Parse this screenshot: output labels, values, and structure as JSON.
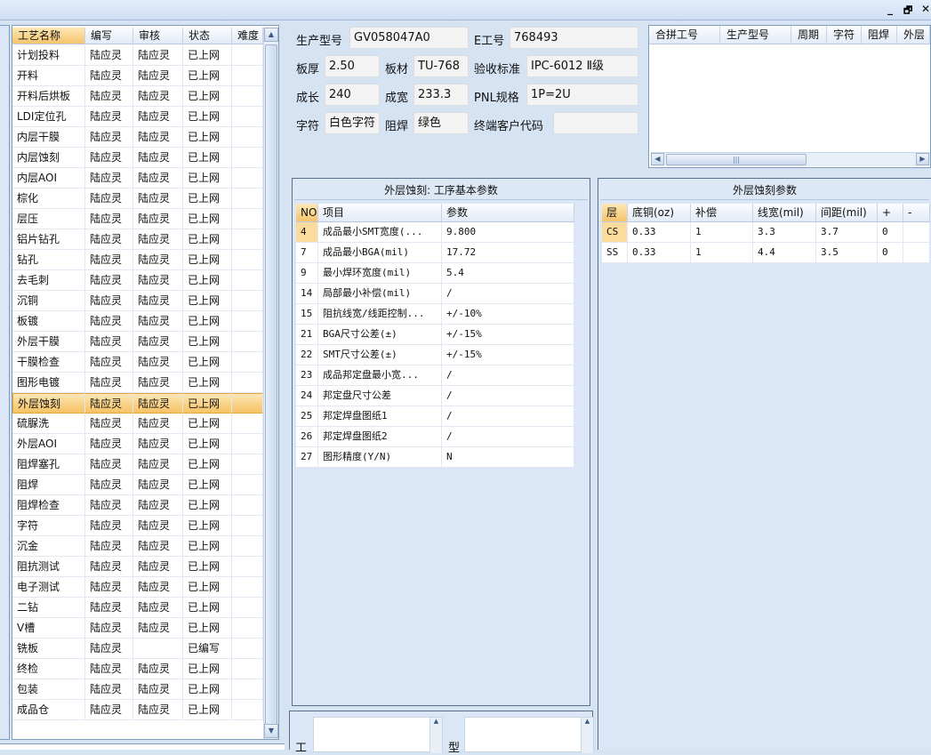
{
  "window": {
    "minimize": "_",
    "restore": "🗗",
    "close": "✕"
  },
  "process_list": {
    "columns": [
      "工艺名称",
      "编写",
      "审核",
      "状态",
      "难度"
    ],
    "rows": [
      [
        "计划投料",
        "陆应灵",
        "陆应灵",
        "已上网",
        ""
      ],
      [
        "开料",
        "陆应灵",
        "陆应灵",
        "已上网",
        ""
      ],
      [
        "开料后烘板",
        "陆应灵",
        "陆应灵",
        "已上网",
        ""
      ],
      [
        "LDI定位孔",
        "陆应灵",
        "陆应灵",
        "已上网",
        ""
      ],
      [
        "内层干膜",
        "陆应灵",
        "陆应灵",
        "已上网",
        ""
      ],
      [
        "内层蚀刻",
        "陆应灵",
        "陆应灵",
        "已上网",
        ""
      ],
      [
        "内层AOI",
        "陆应灵",
        "陆应灵",
        "已上网",
        ""
      ],
      [
        "棕化",
        "陆应灵",
        "陆应灵",
        "已上网",
        ""
      ],
      [
        "层压",
        "陆应灵",
        "陆应灵",
        "已上网",
        ""
      ],
      [
        "铝片钻孔",
        "陆应灵",
        "陆应灵",
        "已上网",
        ""
      ],
      [
        "钻孔",
        "陆应灵",
        "陆应灵",
        "已上网",
        ""
      ],
      [
        "去毛刺",
        "陆应灵",
        "陆应灵",
        "已上网",
        ""
      ],
      [
        "沉铜",
        "陆应灵",
        "陆应灵",
        "已上网",
        ""
      ],
      [
        "板镀",
        "陆应灵",
        "陆应灵",
        "已上网",
        ""
      ],
      [
        "外层干膜",
        "陆应灵",
        "陆应灵",
        "已上网",
        ""
      ],
      [
        "干膜检查",
        "陆应灵",
        "陆应灵",
        "已上网",
        ""
      ],
      [
        "图形电镀",
        "陆应灵",
        "陆应灵",
        "已上网",
        ""
      ],
      [
        "外层蚀刻",
        "陆应灵",
        "陆应灵",
        "已上网",
        ""
      ],
      [
        "硫脲洗",
        "陆应灵",
        "陆应灵",
        "已上网",
        ""
      ],
      [
        "外层AOI",
        "陆应灵",
        "陆应灵",
        "已上网",
        ""
      ],
      [
        "阻焊塞孔",
        "陆应灵",
        "陆应灵",
        "已上网",
        ""
      ],
      [
        "阻焊",
        "陆应灵",
        "陆应灵",
        "已上网",
        ""
      ],
      [
        "阻焊检查",
        "陆应灵",
        "陆应灵",
        "已上网",
        ""
      ],
      [
        "字符",
        "陆应灵",
        "陆应灵",
        "已上网",
        ""
      ],
      [
        "沉金",
        "陆应灵",
        "陆应灵",
        "已上网",
        ""
      ],
      [
        "阻抗测试",
        "陆应灵",
        "陆应灵",
        "已上网",
        ""
      ],
      [
        "电子测试",
        "陆应灵",
        "陆应灵",
        "已上网",
        ""
      ],
      [
        "二钻",
        "陆应灵",
        "陆应灵",
        "已上网",
        ""
      ],
      [
        "V槽",
        "陆应灵",
        "陆应灵",
        "已上网",
        ""
      ],
      [
        "铣板",
        "陆应灵",
        "",
        "已编写",
        ""
      ],
      [
        "终检",
        "陆应灵",
        "陆应灵",
        "已上网",
        ""
      ],
      [
        "包装",
        "陆应灵",
        "陆应灵",
        "已上网",
        ""
      ],
      [
        "成品仓",
        "陆应灵",
        "陆应灵",
        "已上网",
        ""
      ]
    ]
  },
  "info": {
    "model_label": "生产型号",
    "model_value": "GV058047A0",
    "ejob_label": "E工号",
    "ejob_value": "768493",
    "thickness_label": "板厚",
    "thickness_value": "2.50",
    "material_label": "板材",
    "material_value": "TU-768",
    "standard_label": "验收标准",
    "standard_value": "IPC-6012 Ⅱ级",
    "length_label": "成长",
    "length_value": "240",
    "width_label": "成宽",
    "width_value": "233.3",
    "pnl_label": "PNL规格",
    "pnl_value": "1P=2U",
    "char_label": "字符",
    "char_value": "白色字符",
    "mask_label": "阻焊",
    "mask_value": "绿色",
    "customer_label": "终端客户代码",
    "customer_value": ""
  },
  "merge_table": {
    "columns": [
      "合拼工号",
      "生产型号",
      "周期",
      "字符",
      "阻焊",
      "外层"
    ]
  },
  "basic_params": {
    "title": "外层蚀刻: 工序基本参数",
    "columns": [
      "NO",
      "项目",
      "参数"
    ],
    "rows": [
      [
        "4",
        "成品最小SMT宽度(...",
        "9.800"
      ],
      [
        "7",
        "成品最小BGA(mil)",
        "17.72"
      ],
      [
        "9",
        "最小焊环宽度(mil)",
        "5.4"
      ],
      [
        "14",
        "局部最小补偿(mil)",
        "/"
      ],
      [
        "15",
        "阻抗线宽/线距控制...",
        "+/-10%"
      ],
      [
        "21",
        "BGA尺寸公差(±)",
        "+/-15%"
      ],
      [
        "22",
        "SMT尺寸公差(±)",
        "+/-15%"
      ],
      [
        "23",
        "成品邦定盘最小宽...",
        "/"
      ],
      [
        "24",
        "邦定盘尺寸公差",
        "/"
      ],
      [
        "25",
        "邦定焊盘图纸1",
        "/"
      ],
      [
        "26",
        "邦定焊盘图纸2",
        "/"
      ],
      [
        "27",
        "图形精度(Y/N)",
        "N"
      ]
    ]
  },
  "etch_params": {
    "title": "外层蚀刻参数",
    "columns": [
      "层",
      "底铜(oz)",
      "补偿",
      "线宽(mil)",
      "间距(mil)",
      "+",
      "-"
    ],
    "rows": [
      [
        "CS",
        "0.33",
        "1",
        "3.3",
        "3.7",
        "0",
        ""
      ],
      [
        "SS",
        "0.33",
        "1",
        "4.4",
        "3.5",
        "0",
        ""
      ]
    ]
  },
  "bottom": {
    "label_left": "工",
    "label_right": "型"
  }
}
